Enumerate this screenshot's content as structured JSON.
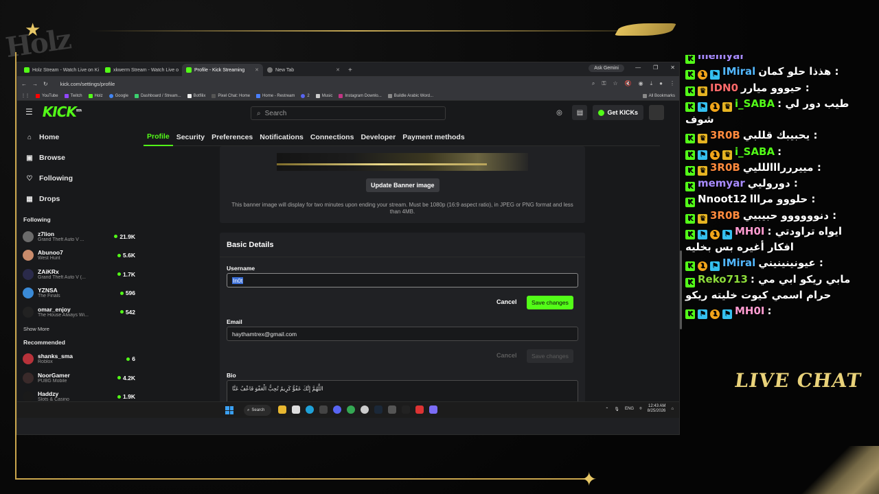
{
  "browser": {
    "tabs": [
      {
        "label": "Holz Stream - Watch Live on Ki",
        "active": false
      },
      {
        "label": "xkwerm Stream - Watch Live o",
        "active": false
      },
      {
        "label": "Profile - Kick Streaming",
        "active": true
      },
      {
        "label": "New Tab",
        "active": false
      }
    ],
    "new_tab": "+",
    "gemini": "Ask Gemini",
    "url": "kick.com/settings/profile",
    "bookmarks": [
      "YouTube",
      "Twitch",
      "Holz",
      "Google",
      "Dashboard / Stream...",
      "Botfilix",
      "Pixel Chat: Home",
      "Home - Restream",
      "2",
      "Music",
      "Instagram Downlo...",
      "Buildle Arabic Word..."
    ],
    "all_bookmarks": "All Bookmarks"
  },
  "kick": {
    "logo": "KICK",
    "beta": "BETA",
    "search_placeholder": "Search",
    "get_kicks": "Get KICKs",
    "nav": [
      {
        "label": "Home",
        "icon": "home-icon",
        "glyph": "⌂"
      },
      {
        "label": "Browse",
        "icon": "browse-icon",
        "glyph": "▣"
      },
      {
        "label": "Following",
        "icon": "heart-icon",
        "glyph": "♡"
      },
      {
        "label": "Drops",
        "icon": "gift-icon",
        "glyph": "▦"
      }
    ],
    "following_title": "Following",
    "following": [
      {
        "name": "z7lion",
        "category": "Grand Theft Auto V ...",
        "viewers": "21.9K",
        "color": "#6b6b6b"
      },
      {
        "name": "Abunoo7",
        "category": "West Hunt",
        "viewers": "5.6K",
        "color": "#c98b6b"
      },
      {
        "name": "ZAiKRx",
        "category": "Grand Theft Auto V (...",
        "viewers": "1.7K",
        "color": "#2a2a4a"
      },
      {
        "name": "YZNSA",
        "category": "The Finals",
        "viewers": "596",
        "color": "#3a8ad6"
      },
      {
        "name": "omar_enjoy",
        "category": "The House Always Wi...",
        "viewers": "542",
        "color": "#222222"
      }
    ],
    "show_more": "Show More",
    "recommended_title": "Recommended",
    "recommended": [
      {
        "name": "shanks_sma",
        "category": "Roblox",
        "viewers": "6",
        "color": "#b8323a"
      },
      {
        "name": "NoorGamer",
        "category": "PUBG Mobile",
        "viewers": "4.2K",
        "color": "#3a2a2a"
      },
      {
        "name": "Haddzy",
        "category": "Slots & Casino",
        "viewers": "1.9K",
        "color": "#1a1a1a"
      }
    ],
    "settings_tabs": [
      "Profile",
      "Security",
      "Preferences",
      "Notifications",
      "Connections",
      "Developer",
      "Payment methods"
    ],
    "banner": {
      "update_label": "Update Banner image",
      "note": "This banner image will display for two minutes upon ending your stream. Must be 1080p (16:9 aspect ratio), in JPEG or PNG format and less than 4MB."
    },
    "basic": {
      "title": "Basic Details",
      "username_label": "Username",
      "username_value": "In0t",
      "cancel": "Cancel",
      "save": "Save changes",
      "email_label": "Email",
      "email_value": "haythamtrex@gmail.com",
      "bio_label": "Bio",
      "bio_value": "اللَّهُمَّ إِنَّكَ عَفُوٌّ كَرِيمٌ تُحِبُّ الْعَفْوَ فَاعْفُ عَنَّا"
    }
  },
  "taskbar": {
    "search": "Search",
    "lang": "ENG",
    "time": "12:43 AM",
    "date": "8/25/2026"
  },
  "chat": {
    "title": "LIVE CHAT",
    "messages": [
      {
        "badges": [
          "kb"
        ],
        "name": "memyar",
        "name_color": "#a88bff",
        "text": ""
      },
      {
        "badges": [
          "kb",
          "one",
          "sub"
        ],
        "name": "IMiral",
        "name_color": "#53b8ff",
        "text": "هذذا حلو كمان :"
      },
      {
        "badges": [
          "kb",
          "crown"
        ],
        "name": "IDN0",
        "name_color": "#ff6a6a",
        "text": "حيووو ميارر :"
      },
      {
        "badges": [
          "kb",
          "sub",
          "one",
          "crown"
        ],
        "name": "i_SABA",
        "name_color": "#53fc18",
        "text": "طيب دور لي : شوف"
      },
      {
        "badges": [
          "kb",
          "crown"
        ],
        "name": "3R0B",
        "name_color": "#ff8a3d",
        "text": "يحبيبك قللبي :"
      },
      {
        "badges": [
          "kb",
          "sub",
          "one",
          "crown"
        ],
        "name": "i_SABA",
        "name_color": "#53fc18",
        "text": ":"
      },
      {
        "badges": [
          "kb",
          "crown"
        ],
        "name": "3R0B",
        "name_color": "#ff8a3d",
        "text": "مييررراااللليي :"
      },
      {
        "badges": [
          "kb"
        ],
        "name": "memyar",
        "name_color": "#a88bff",
        "text": "دوروليي :"
      },
      {
        "badges": [
          "kb"
        ],
        "name": "Nnoot12",
        "name_color": "#ffffff",
        "text": "حلووو مرااا :"
      },
      {
        "badges": [
          "kb",
          "crown"
        ],
        "name": "3R0B",
        "name_color": "#ff8a3d",
        "text": "دنوووووو حبيبيي :"
      },
      {
        "badges": [
          "kb",
          "sub",
          "one",
          "sub"
        ],
        "name": "MH0I",
        "name_color": "#ff9bd0",
        "text": "ايواه تراودتي : افكار أغيره بس بخليه"
      },
      {
        "badges": [
          "kb",
          "one",
          "sub"
        ],
        "name": "IMiral",
        "name_color": "#53b8ff",
        "text": "عيونينينيني :"
      },
      {
        "badges": [
          "kb"
        ],
        "name": "Reko713",
        "name_color": "#8ddc3a",
        "text": "مابي ريكو ابي مي : حرام اسمي كيوت خليته ريكو"
      },
      {
        "badges": [
          "kb",
          "sub",
          "one",
          "sub"
        ],
        "name": "MH0I",
        "name_color": "#ff9bd0",
        "text": ":"
      }
    ]
  }
}
